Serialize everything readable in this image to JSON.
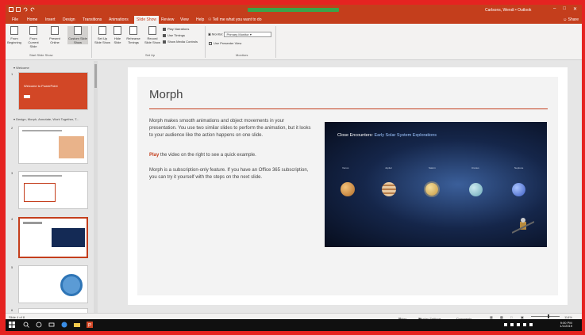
{
  "titlebar": {
    "user": "Carlsons, Wendi • Outlook"
  },
  "tabs": [
    {
      "label": "File"
    },
    {
      "label": "Home"
    },
    {
      "label": "Insert"
    },
    {
      "label": "Design"
    },
    {
      "label": "Transitions"
    },
    {
      "label": "Animations"
    },
    {
      "label": "Slide Show"
    },
    {
      "label": "Review"
    },
    {
      "label": "View"
    },
    {
      "label": "Help"
    }
  ],
  "tell_me": "Tell me what you want to do",
  "share": "Share",
  "ribbon": {
    "from_beginning": "From Beginning",
    "from_current": "From Current Slide",
    "present_online": "Present Online",
    "custom_show": "Custom Slide Show",
    "group_start": "Start Slide Show",
    "setup_show": "Set Up Slide Show",
    "hide_slide": "Hide Slide",
    "rehearse": "Rehearse Timings",
    "record": "Record Slide Show",
    "play_narrations": "Play Narrations",
    "use_timings": "Use Timings",
    "show_media": "Show Media Controls",
    "group_setup": "Set Up",
    "monitor_label": "Monitor:",
    "monitor_value": "Primary Monitor",
    "presenter_view": "Use Presenter View",
    "group_monitors": "Monitors"
  },
  "panel": {
    "section1": "Welcome",
    "section2": "Design, Morph, Annotate, Work Together, T...",
    "thumb1_title": "Welcome to PowerPoint",
    "thumb_nums": [
      "1",
      "2",
      "3",
      "4",
      "5",
      "6"
    ]
  },
  "slide": {
    "title": "Morph",
    "p1": "Morph makes smooth animations and object movements in your presentation. You use two similar slides to perform the animation, but it looks to your audience like the action happens on one slide.",
    "play_word": "Play",
    "p2_rest": " the video on the right to see a quick example.",
    "p3": "Morph is a subscription-only feature. If you have an Office 365 subscription, you can try it yourself with the steps on the next slide.",
    "video_title_a": "Close Encounters: ",
    "video_title_b": "Early Solar System Explorations",
    "planet_labels": [
      "Venus",
      "Jupiter",
      "Saturn",
      "Uranus",
      "Neptune"
    ]
  },
  "status": {
    "slide_of": "Slide 4 of 8",
    "notes": "Notes",
    "display": "Display Settings",
    "comments": "Comments",
    "zoom": "114%"
  },
  "taskbar": {
    "time": "9:00 PM",
    "date": "1/1/2019"
  },
  "colors": {
    "accent": "#c43e1c",
    "frame": "#e52321"
  }
}
